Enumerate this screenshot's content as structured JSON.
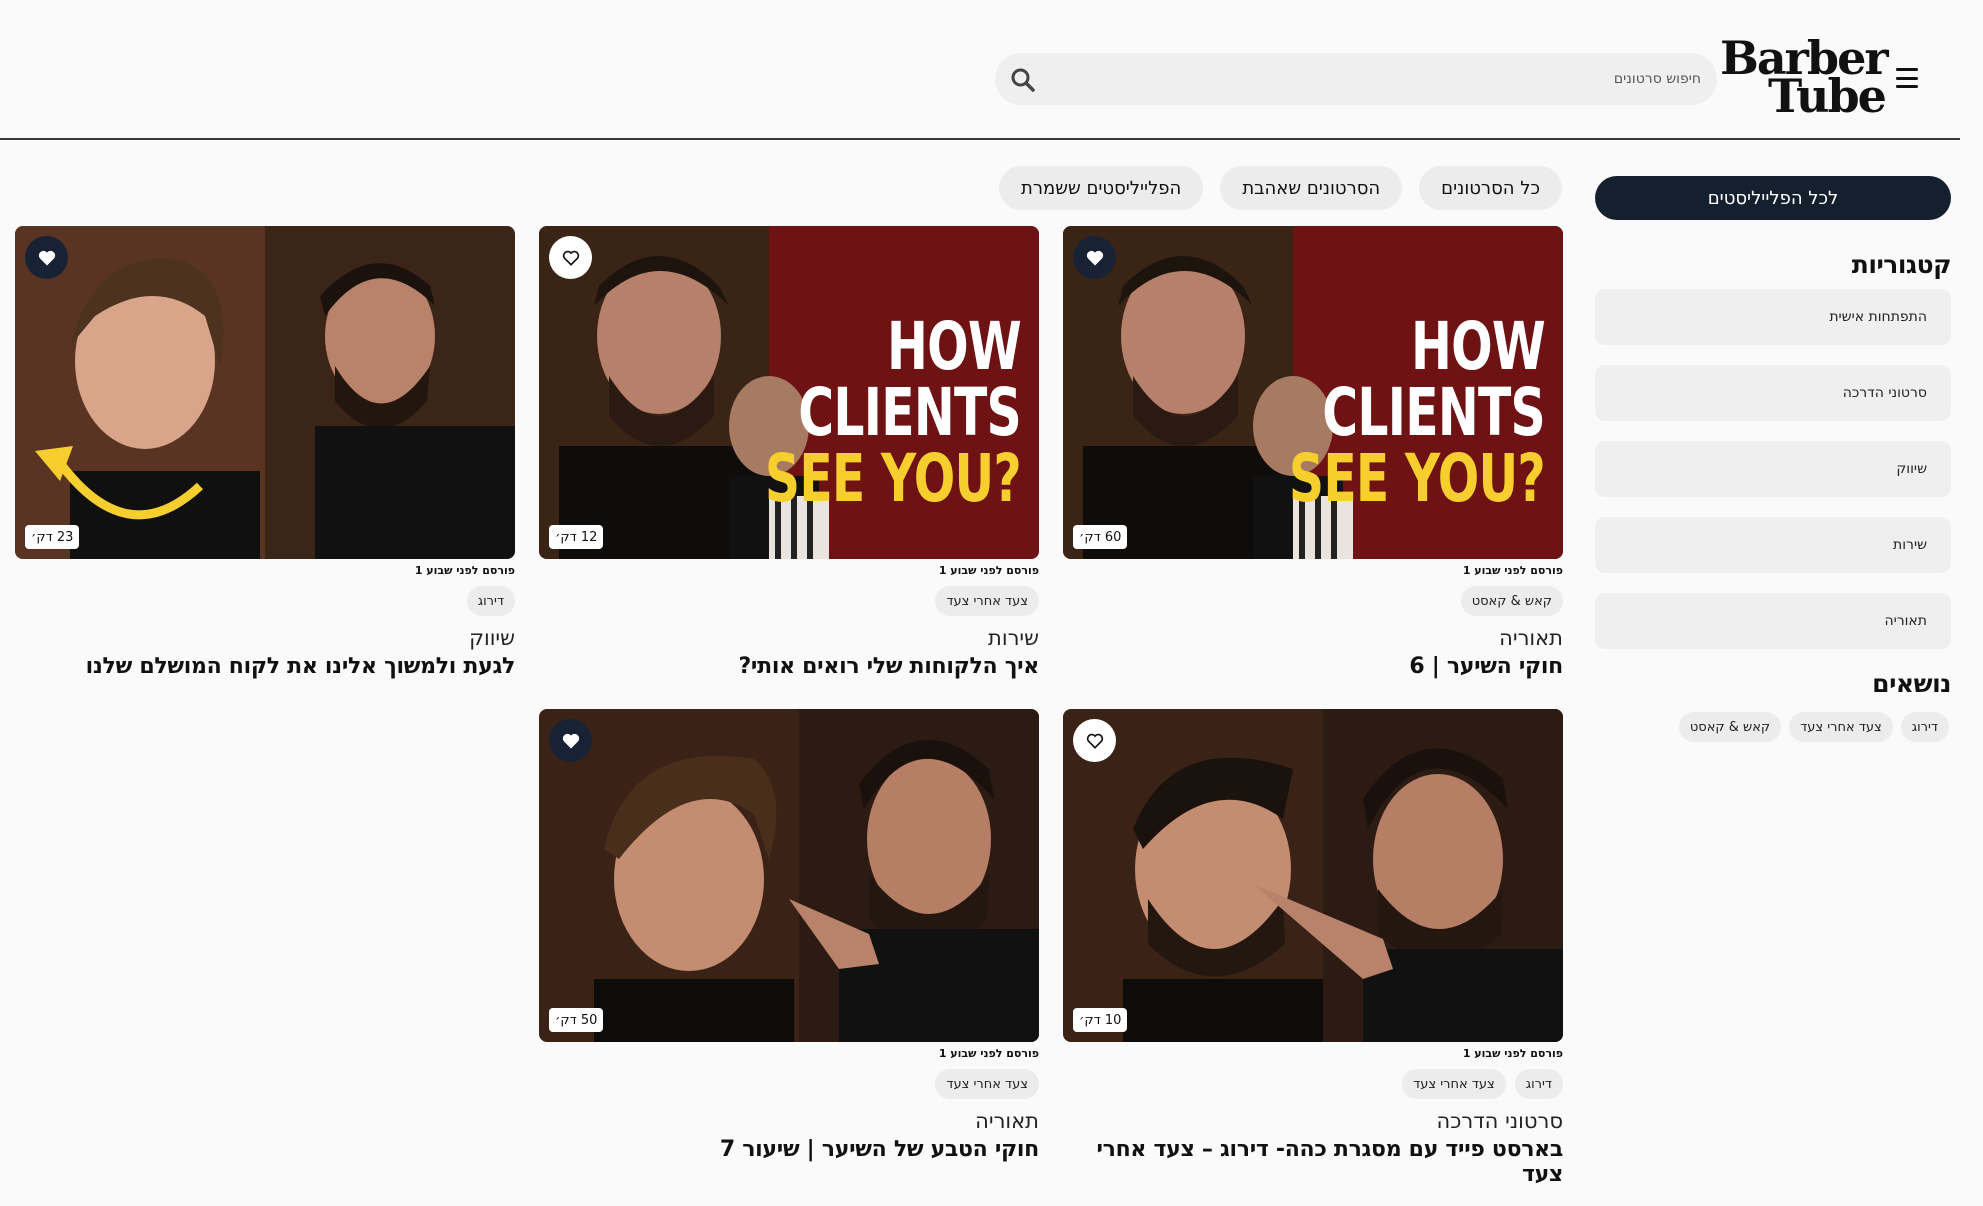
{
  "header": {
    "logo_line1": "Barber",
    "logo_line2": "Tube",
    "search_placeholder": "חיפוש סרטונים"
  },
  "sidebar": {
    "all_playlists_label": "לכל הפלייליסטים",
    "categories_heading": "קטגוריות",
    "categories": [
      "התפתחות אישית",
      "סרטוני הדרכה",
      "שיווק",
      "שירות",
      "תאוריה"
    ],
    "topics_heading": "נושאים",
    "topics": [
      "דירוג",
      "צעד אחרי צעד",
      "קאש & קאסט"
    ]
  },
  "tabs": [
    "כל הסרטונים",
    "הסרטונים שאהבת",
    "הפלייליסטים ששמרת"
  ],
  "videos": [
    {
      "duration": "60 דק׳",
      "favorited": true,
      "published": "פורסם לפני שבוע 1",
      "tags": [
        "קאש & קאסט"
      ],
      "category": "תאוריה",
      "title": "חוקי השיער | 6",
      "thumb_text": [
        "HOW CLIENTS",
        "SEE YOU?"
      ]
    },
    {
      "duration": "12 דק׳",
      "favorited": false,
      "published": "פורסם לפני שבוע 1",
      "tags": [
        "צעד אחרי צעד"
      ],
      "category": "שירות",
      "title": "איך הלקוחות שלי רואים אותי?",
      "thumb_text": [
        "HOW CLIENTS",
        "SEE YOU?"
      ]
    },
    {
      "duration": "23 דק׳",
      "favorited": true,
      "published": "פורסם לפני שבוע 1",
      "tags": [
        "דירוג"
      ],
      "category": "שיווק",
      "title": "לגעת ולמשוך אלינו את לקוח המושלם שלנו"
    },
    {
      "duration": "10 דק׳",
      "favorited": false,
      "published": "פורסם לפני שבוע 1",
      "tags": [
        "דירוג",
        "צעד אחרי צעד"
      ],
      "category": "סרטוני הדרכה",
      "title": "בארסט פייד עם מסגרת כהה- דירוג – צעד אחרי צעד"
    },
    {
      "duration": "50 דק׳",
      "favorited": true,
      "published": "פורסם לפני שבוע 1",
      "tags": [
        "צעד אחרי צעד"
      ],
      "category": "תאוריה",
      "title": "חוקי הטבע של השיער | שיעור 7"
    }
  ],
  "colors": {
    "primary_dark": "#15202e",
    "chip_bg": "#ececec",
    "thumb_red": "#7a1416",
    "thumb_yellow": "#f6cf2f"
  }
}
